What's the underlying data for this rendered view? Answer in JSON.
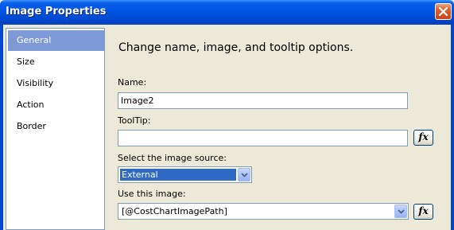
{
  "window": {
    "title": "Image Properties"
  },
  "nav": {
    "items": [
      {
        "label": "General",
        "selected": true
      },
      {
        "label": "Size",
        "selected": false
      },
      {
        "label": "Visibility",
        "selected": false
      },
      {
        "label": "Action",
        "selected": false
      },
      {
        "label": "Border",
        "selected": false
      }
    ]
  },
  "content": {
    "heading": "Change name, image, and tooltip options.",
    "name_label": "Name:",
    "name_value": "Image2",
    "tooltip_label": "ToolTip:",
    "tooltip_value": "",
    "fx_label": "fx",
    "source_label": "Select the image source:",
    "source_value": "External",
    "image_label": "Use this image:",
    "image_value": "[@CostChartImagePath]"
  },
  "colors": {
    "titlebar": "#0055e5",
    "nav_selected": "#7d9ad6",
    "selection_highlight": "#316ac5"
  }
}
